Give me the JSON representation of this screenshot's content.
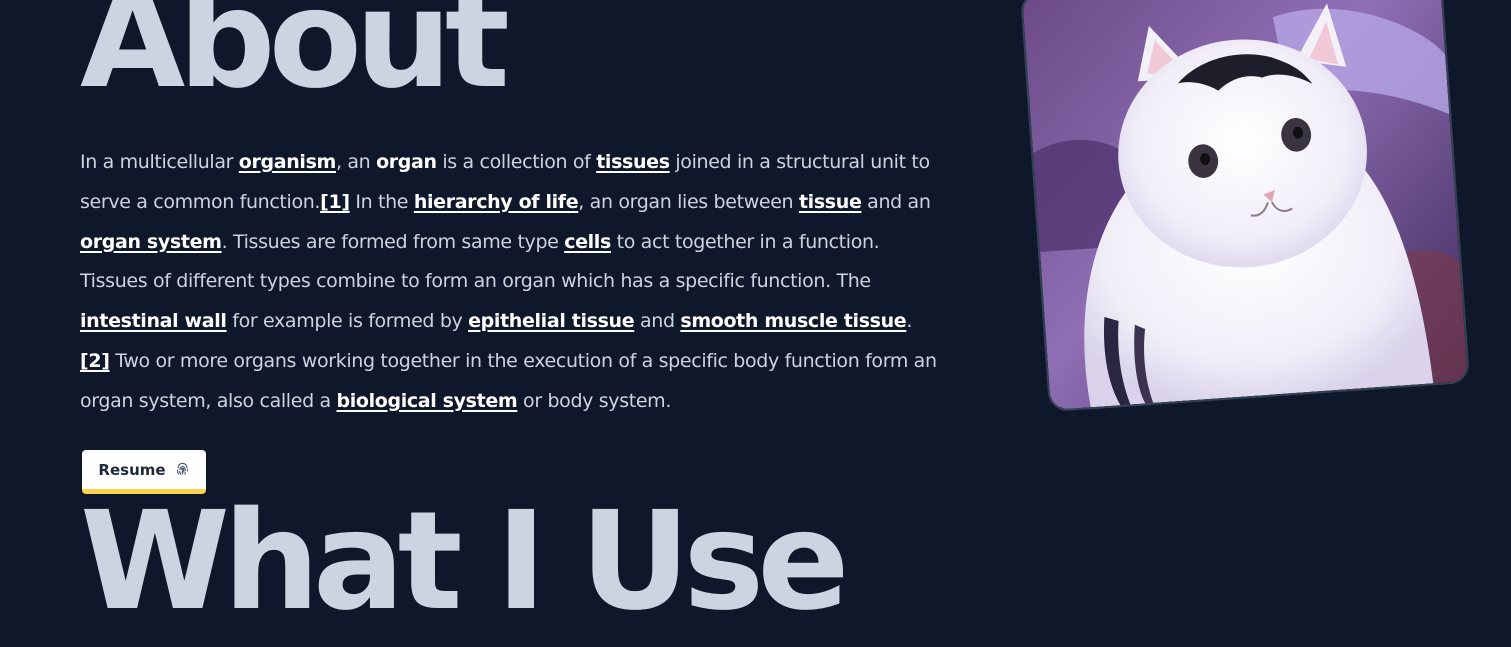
{
  "about": {
    "title": "About",
    "paragraph": [
      {
        "t": "In a multicellular "
      },
      {
        "t": "organism",
        "link": true
      },
      {
        "t": ", an "
      },
      {
        "t": "organ",
        "bold": true
      },
      {
        "t": " is a collection of "
      },
      {
        "t": "tissues",
        "link": true
      },
      {
        "t": " joined in a structural unit to serve a common function."
      },
      {
        "t": "[1]",
        "link": true
      },
      {
        "t": " In the "
      },
      {
        "t": "hierarchy of life",
        "link": true
      },
      {
        "t": ", an organ lies between "
      },
      {
        "t": "tissue",
        "link": true
      },
      {
        "t": " and an "
      },
      {
        "t": "organ system",
        "link": true
      },
      {
        "t": ". Tissues are formed from same type "
      },
      {
        "t": "cells",
        "link": true
      },
      {
        "t": " to act together in a function. Tissues of different types combine to form an organ which has a specific function. The "
      },
      {
        "t": "intestinal wall",
        "link": true
      },
      {
        "t": " for example is formed by "
      },
      {
        "t": "epithelial tissue",
        "link": true
      },
      {
        "t": " and "
      },
      {
        "t": "smooth muscle tissue",
        "link": true
      },
      {
        "t": "."
      },
      {
        "t": "[2]",
        "link": true
      },
      {
        "t": " Two or more organs working together in the execution of a specific body function form an organ system, also called a "
      },
      {
        "t": "biological system",
        "link": true
      },
      {
        "t": " or body system."
      }
    ],
    "resume_label": "Resume",
    "resume_icon": "fingerprint-icon",
    "photo_subject": "white-cat-photo"
  },
  "section2": {
    "title": "What I Use"
  },
  "colors": {
    "background": "#0f172a",
    "heading": "#cbd5e1",
    "body_text": "#cbd5e1",
    "link": "#ffffff",
    "button_bg": "#ffffff",
    "button_accent": "#fcd34d"
  }
}
